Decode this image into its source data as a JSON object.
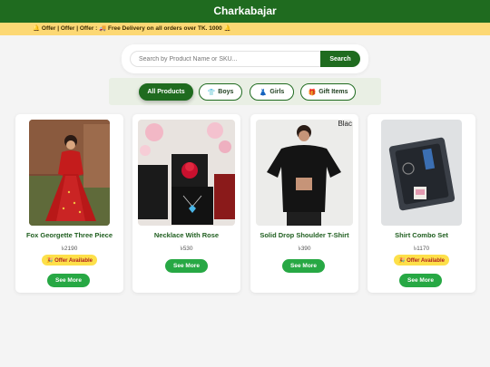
{
  "header": {
    "title": "Charkabajar"
  },
  "offer_bar": {
    "text": "🔔 Offer | Offer | Offer : 🚚 Free Delivery on all orders over TK. 1000 🔔"
  },
  "search": {
    "placeholder": "Search by Product Name or SKU...",
    "button_label": "Search"
  },
  "categories": [
    {
      "label": "All Products",
      "icon": "",
      "active": true
    },
    {
      "label": "Boys",
      "icon": "👕",
      "active": false
    },
    {
      "label": "Girls",
      "icon": "👗",
      "active": false
    },
    {
      "label": "Gift Items",
      "icon": "🎁",
      "active": false
    }
  ],
  "products": [
    {
      "name": "Fox Georgette Three Piece",
      "price": "৳2190",
      "offer": "🎉 Offer Available",
      "more": "See More"
    },
    {
      "name": "Necklace With Rose",
      "price": "৳530",
      "more": "See More"
    },
    {
      "name": "Solid Drop Shoulder T-Shirt",
      "price": "৳390",
      "more": "See More",
      "image_text": "Blac"
    },
    {
      "name": "Shirt Combo Set",
      "price": "৳1170",
      "offer": "🎉 Offer Available",
      "more": "See More"
    }
  ]
}
